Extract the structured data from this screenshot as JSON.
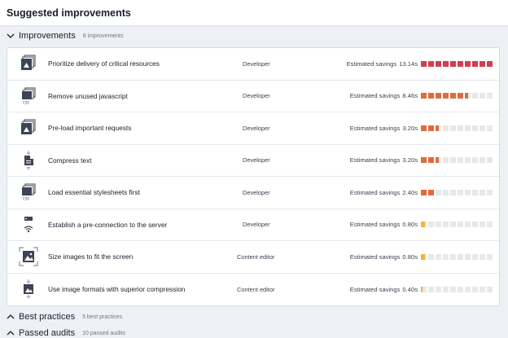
{
  "page": {
    "title": "Suggested improvements"
  },
  "colors": {
    "red": "#d63c4f",
    "orange": "#e06b3c",
    "yellow": "#f0b43c",
    "empty": "#e6e8eb"
  },
  "sections": {
    "improvements": {
      "label": "Improvements",
      "count": "8 improvements",
      "expanded": true
    },
    "best_practices": {
      "label": "Best practices",
      "count": "5 best practices",
      "expanded": false
    },
    "passed_audits": {
      "label": "Passed audits",
      "count": "10 passed audits",
      "expanded": false
    }
  },
  "savings_prefix": "Estimated savings",
  "items": [
    {
      "title": "Prioritize delivery of critical resources",
      "role": "Developer",
      "savings": "13.14s",
      "level": 10,
      "color": "red",
      "icon": "stacked-image-icon"
    },
    {
      "title": "Remove unused javascript",
      "role": "Developer",
      "savings": "8.46s",
      "level": 6.5,
      "color": "orange",
      "icon": "css-files-icon"
    },
    {
      "title": "Pre-load important requests",
      "role": "Developer",
      "savings": "3.20s",
      "level": 2.5,
      "color": "orange",
      "icon": "stacked-image-icon"
    },
    {
      "title": "Compress text",
      "role": "Developer",
      "savings": "3.20s",
      "level": 2.5,
      "color": "orange",
      "icon": "compress-document-icon"
    },
    {
      "title": "Load essential stylesheets first",
      "role": "Developer",
      "savings": "2.40s",
      "level": 2,
      "color": "orange",
      "icon": "css-files-icon"
    },
    {
      "title": "Establish a pre-connection to the server",
      "role": "Developer",
      "savings": "0.80s",
      "level": 0.7,
      "color": "yellow",
      "icon": "server-wifi-icon"
    },
    {
      "title": "Size images to fit the screen",
      "role": "Content editor",
      "savings": "0.80s",
      "level": 0.7,
      "color": "yellow",
      "icon": "resize-image-icon"
    },
    {
      "title": "Use image formats with superior compression",
      "role": "Content editor",
      "savings": "0.40s",
      "level": 0.35,
      "color": "yellow",
      "icon": "compress-image-icon"
    }
  ]
}
